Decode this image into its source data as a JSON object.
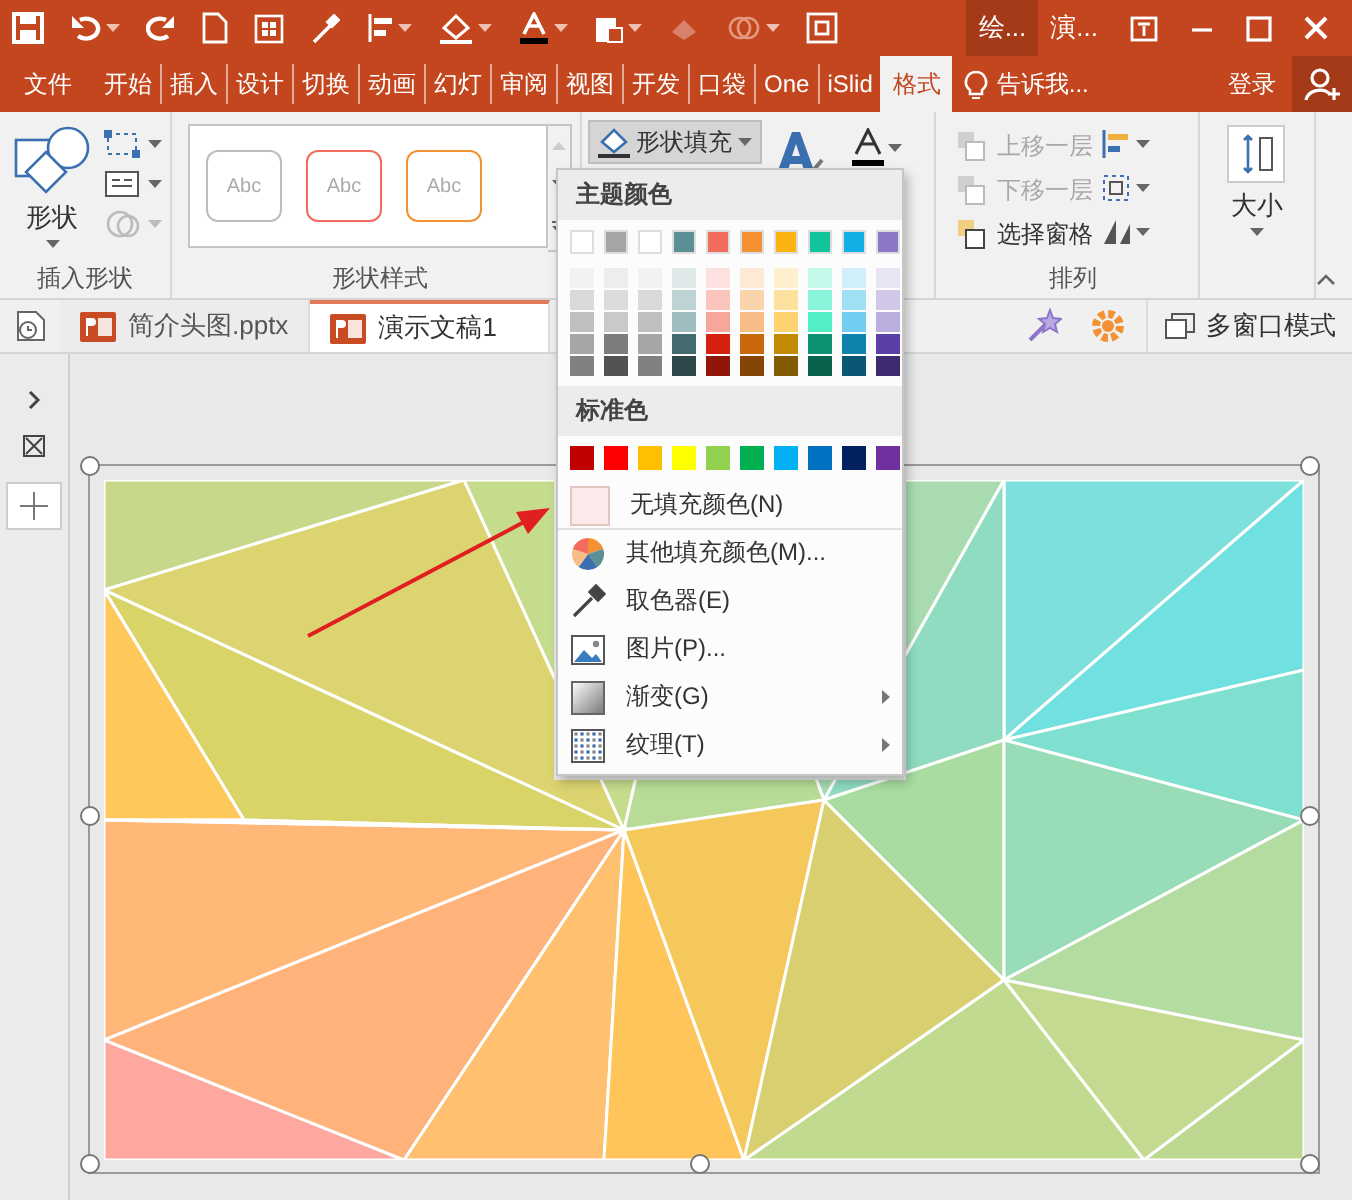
{
  "title_bar": {
    "contextual_tab": "绘...",
    "window_title": "演..."
  },
  "ribbon_tabs": [
    {
      "label": "文件",
      "selected": false
    },
    {
      "label": "开始",
      "selected": false
    },
    {
      "label": "插入",
      "selected": false
    },
    {
      "label": "设计",
      "selected": false
    },
    {
      "label": "切换",
      "selected": false
    },
    {
      "label": "动画",
      "selected": false
    },
    {
      "label": "幻灯",
      "selected": false
    },
    {
      "label": "审阅",
      "selected": false
    },
    {
      "label": "视图",
      "selected": false
    },
    {
      "label": "开发",
      "selected": false
    },
    {
      "label": "口袋",
      "selected": false
    },
    {
      "label": "One",
      "selected": false
    },
    {
      "label": "iSlid",
      "selected": false
    },
    {
      "label": "格式",
      "selected": true
    }
  ],
  "tell_me": "告诉我...",
  "sign_in": "登录",
  "ribbon": {
    "insert_shapes": {
      "shape_button": "形状",
      "group_label": "插入形状"
    },
    "shape_styles": {
      "samples": [
        {
          "label": "Abc",
          "color": "#bdbdbd"
        },
        {
          "label": "Abc",
          "color": "#f26b5b"
        },
        {
          "label": "Abc",
          "color": "#f39133"
        }
      ],
      "group_label": "形状样式"
    },
    "shape_fill": {
      "label": "形状填充",
      "expanded": true
    },
    "arrange": {
      "items": [
        {
          "label": "上移一层",
          "disabled": true
        },
        {
          "label": "下移一层",
          "disabled": true
        },
        {
          "label": "选择窗格",
          "disabled": false
        }
      ],
      "group_label": "排列"
    },
    "size": {
      "label": "大小"
    }
  },
  "doc_tabs": [
    {
      "label": "简介头图.pptx",
      "selected": false
    },
    {
      "label": "演示文稿1",
      "selected": true
    }
  ],
  "multi_window_button": "多窗口模式",
  "fill_menu": {
    "theme_header": "主题颜色",
    "theme_colors": [
      {
        "color": "#ffffff",
        "shades": [
          {
            "color": "#f2f2f2"
          },
          {
            "color": "#d9d9d9"
          },
          {
            "color": "#bfbfbf"
          },
          {
            "color": "#a6a6a6"
          },
          {
            "color": "#808080"
          }
        ]
      },
      {
        "color": "#a5a5a5",
        "shades": [
          {
            "color": "#ededed"
          },
          {
            "color": "#dbdbdb"
          },
          {
            "color": "#c9c9c9"
          },
          {
            "color": "#7c7c7c"
          },
          {
            "color": "#525252"
          }
        ]
      },
      {
        "color": "#ffffff",
        "shades": [
          {
            "color": "#f2f2f2"
          },
          {
            "color": "#d9d9d9"
          },
          {
            "color": "#bfbfbf"
          },
          {
            "color": "#a6a6a6"
          },
          {
            "color": "#808080"
          }
        ]
      },
      {
        "color": "#5b8f95",
        "shades": [
          {
            "color": "#dfe9ea"
          },
          {
            "color": "#bfd3d5"
          },
          {
            "color": "#9fbdc0"
          },
          {
            "color": "#446b70"
          },
          {
            "color": "#2d474a"
          }
        ]
      },
      {
        "color": "#f26b5b",
        "shades": [
          {
            "color": "#fde1de"
          },
          {
            "color": "#fbc4bd"
          },
          {
            "color": "#f8a69c"
          },
          {
            "color": "#d7210e"
          },
          {
            "color": "#8f1609"
          }
        ]
      },
      {
        "color": "#f39133",
        "shades": [
          {
            "color": "#fde9d6"
          },
          {
            "color": "#fad3ad"
          },
          {
            "color": "#f8bd85"
          },
          {
            "color": "#c9680b"
          },
          {
            "color": "#864507"
          }
        ]
      },
      {
        "color": "#fbb40f",
        "shades": [
          {
            "color": "#fef0cf"
          },
          {
            "color": "#fde19f"
          },
          {
            "color": "#fdd26f"
          },
          {
            "color": "#c38903"
          },
          {
            "color": "#825b02"
          }
        ]
      },
      {
        "color": "#12c49a",
        "shades": [
          {
            "color": "#c5f9ec"
          },
          {
            "color": "#8bf4da"
          },
          {
            "color": "#51eec7"
          },
          {
            "color": "#0d9373"
          },
          {
            "color": "#08624d"
          }
        ]
      },
      {
        "color": "#14aee6",
        "shades": [
          {
            "color": "#d0effa"
          },
          {
            "color": "#a1dff5"
          },
          {
            "color": "#72cef1"
          },
          {
            "color": "#0f83ad"
          },
          {
            "color": "#0a5773"
          }
        ]
      },
      {
        "color": "#8c76c8",
        "shades": [
          {
            "color": "#e8e4f4"
          },
          {
            "color": "#d1c8e9"
          },
          {
            "color": "#bbaddd"
          },
          {
            "color": "#5b3fa6"
          },
          {
            "color": "#3d2a6f"
          }
        ]
      }
    ],
    "standard_header": "标准色",
    "standard_colors": [
      {
        "color": "#c00000"
      },
      {
        "color": "#ff0000"
      },
      {
        "color": "#ffc000"
      },
      {
        "color": "#ffff00"
      },
      {
        "color": "#92d050"
      },
      {
        "color": "#00b050"
      },
      {
        "color": "#00b0f0"
      },
      {
        "color": "#0070c0"
      },
      {
        "color": "#002060"
      },
      {
        "color": "#7030a0"
      }
    ],
    "items": [
      {
        "kind": "no-fill",
        "label": "无填充颜色(N)",
        "submenu": false
      },
      {
        "kind": "more-colors",
        "label": "其他填充颜色(M)...",
        "submenu": false
      },
      {
        "kind": "eyedropper",
        "label": "取色器(E)",
        "submenu": false
      },
      {
        "kind": "picture",
        "label": "图片(P)...",
        "submenu": false
      },
      {
        "kind": "gradient",
        "label": "渐变(G)",
        "submenu": true
      },
      {
        "kind": "texture",
        "label": "纹理(T)",
        "submenu": true
      }
    ]
  }
}
